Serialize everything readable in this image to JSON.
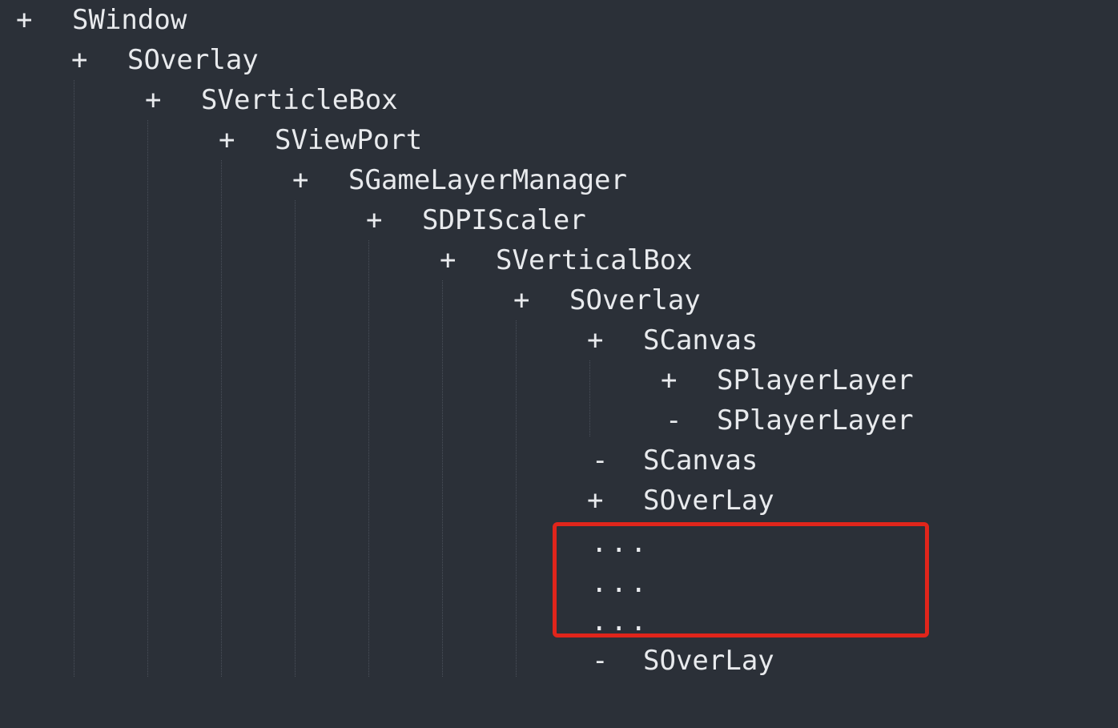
{
  "tree": {
    "rows": [
      {
        "symbol": "+",
        "label": "SWindow",
        "depth": 0
      },
      {
        "symbol": "+",
        "label": "SOverlay",
        "depth": 1
      },
      {
        "symbol": "+",
        "label": "SVerticleBox",
        "depth": 2
      },
      {
        "symbol": "+",
        "label": "SViewPort",
        "depth": 3
      },
      {
        "symbol": "+",
        "label": "SGameLayerManager",
        "depth": 4
      },
      {
        "symbol": "+",
        "label": "SDPIScaler",
        "depth": 5
      },
      {
        "symbol": "+",
        "label": "SVerticalBox",
        "depth": 6
      },
      {
        "symbol": "+",
        "label": "SOverlay",
        "depth": 7
      },
      {
        "symbol": "+",
        "label": "SCanvas",
        "depth": 8
      },
      {
        "symbol": "+",
        "label": "SPlayerLayer",
        "depth": 9
      },
      {
        "symbol": "-",
        "label": "SPlayerLayer",
        "depth": 9
      },
      {
        "symbol": "-",
        "label": "SCanvas",
        "depth": 8
      },
      {
        "symbol": "+",
        "label": "SOverLay",
        "depth": 8
      },
      {
        "symbol": "-",
        "label": "SOverLay",
        "depth": 8
      }
    ],
    "ellipsis": [
      "...",
      "...",
      "..."
    ]
  },
  "colors": {
    "background": "#2b3038",
    "text": "#e8eaed",
    "highlight": "#e0251b",
    "guide": "#4a505a"
  }
}
